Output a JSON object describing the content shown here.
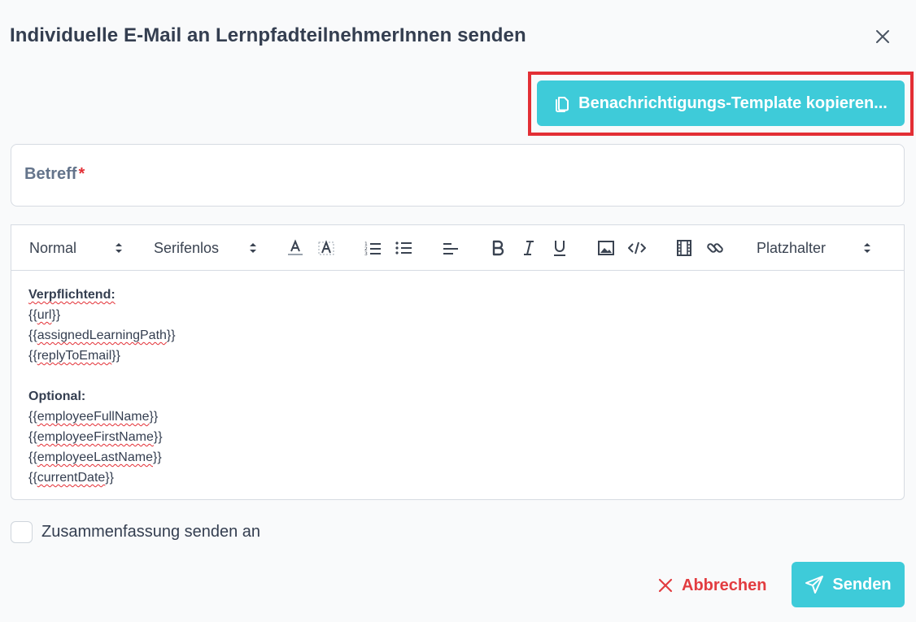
{
  "dialog": {
    "title": "Individuelle E-Mail an LernpfadteilnehmerInnen senden"
  },
  "copy_template": {
    "label": "Benachrichtigungs-Template kopieren..."
  },
  "subject": {
    "label": "Betreff",
    "required_mark": "*"
  },
  "toolbar": {
    "header_select": "Normal",
    "font_select": "Serifenlos",
    "placeholder_select": "Platzhalter"
  },
  "body": {
    "required_heading": "Verpflichtend:",
    "required_items": [
      "{{url}}",
      "{{assignedLearningPath}}",
      "{{replyToEmail}}"
    ],
    "optional_heading": "Optional:",
    "optional_items": [
      "{{employeeFullName}}",
      "{{employeeFirstName}}",
      "{{employeeLastName}}",
      "{{currentDate}}"
    ]
  },
  "summary": {
    "label": "Zusammenfassung senden an",
    "checked": false
  },
  "actions": {
    "cancel_label": "Abbrechen",
    "send_label": "Senden"
  },
  "colors": {
    "accent": "#3ecbd9",
    "danger": "#e23c40",
    "highlight_border": "#e32f35"
  }
}
